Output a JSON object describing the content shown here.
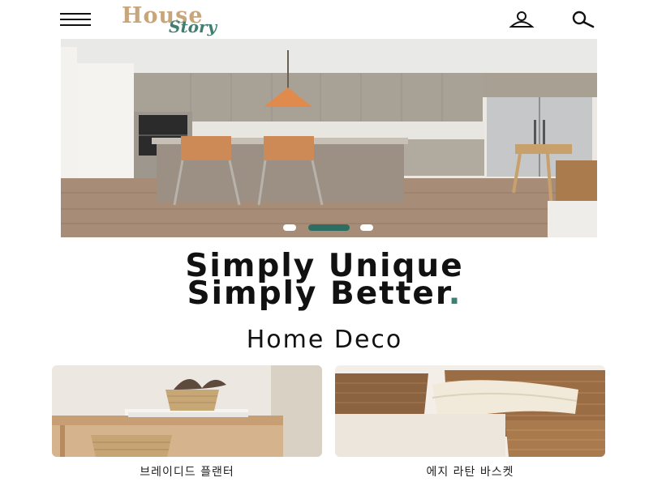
{
  "header": {
    "logo_top": "House",
    "logo_bottom": "Story",
    "menu_icon": "hamburger-menu-icon",
    "user_icon": "user-icon",
    "search_icon": "search-icon"
  },
  "hero": {
    "slide_count": 3,
    "active_slide": 2
  },
  "headline": {
    "line1": "Simply Unique",
    "line2": "Simply Better",
    "accent": "."
  },
  "section": {
    "title": "Home Deco"
  },
  "products": [
    {
      "name": "브레이디드 플랜터"
    },
    {
      "name": "에지 라탄 바스켓"
    }
  ],
  "colors": {
    "brand_gold": "#c7a67c",
    "brand_green": "#3f7e70",
    "active_dot": "#2e6e62"
  }
}
